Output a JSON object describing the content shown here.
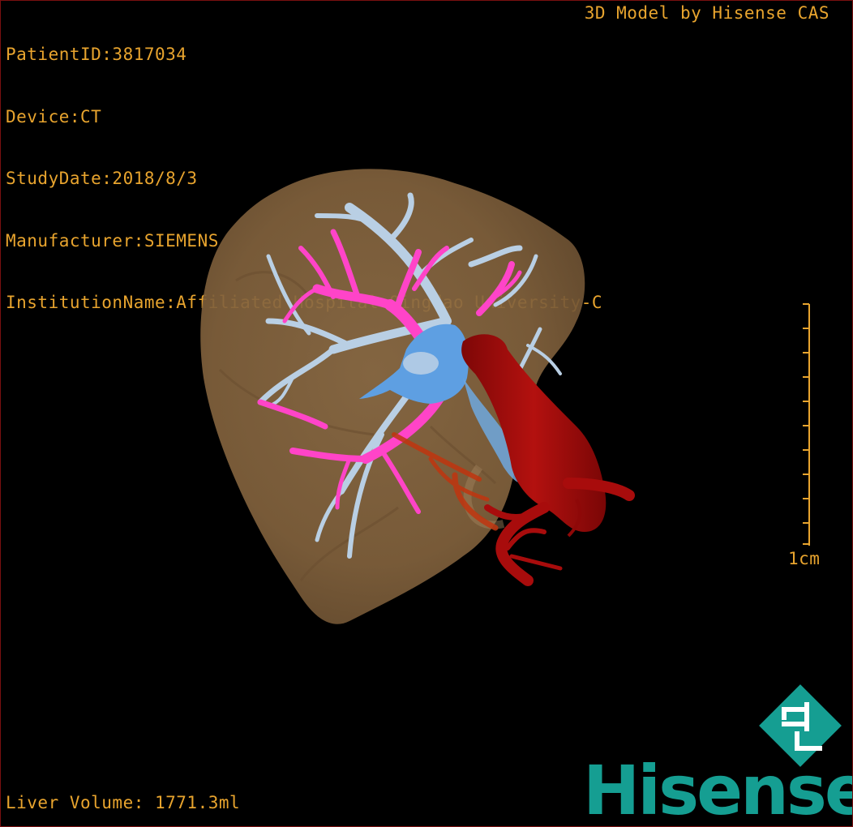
{
  "header": {
    "patient_id": "PatientID:3817034",
    "device": "Device:CT",
    "study_date": "StudyDate:2018/8/3",
    "manufacturer": "Manufacturer:SIEMENS",
    "institution": "InstitutionName:Affiliated Hospital Qingdao University-C",
    "watermark": "3D Model by Hisense CAS"
  },
  "footer": {
    "liver_volume": "Liver Volume: 1771.3ml"
  },
  "scale_bar": {
    "label": "1cm"
  },
  "logo": {
    "brand": "Hisense",
    "mark": "HL"
  },
  "colors": {
    "text": "#e8a42e",
    "border": "#7a1010",
    "liver": "#8b6a44",
    "portal_vein": "#ff44c8",
    "hepatic_vein": "#b9cfe4",
    "ivc": "#5e9fe2",
    "aorta": "#a80c0c",
    "brand": "#159e92"
  },
  "icons": [
    "hisense-hl-logo-icon"
  ]
}
